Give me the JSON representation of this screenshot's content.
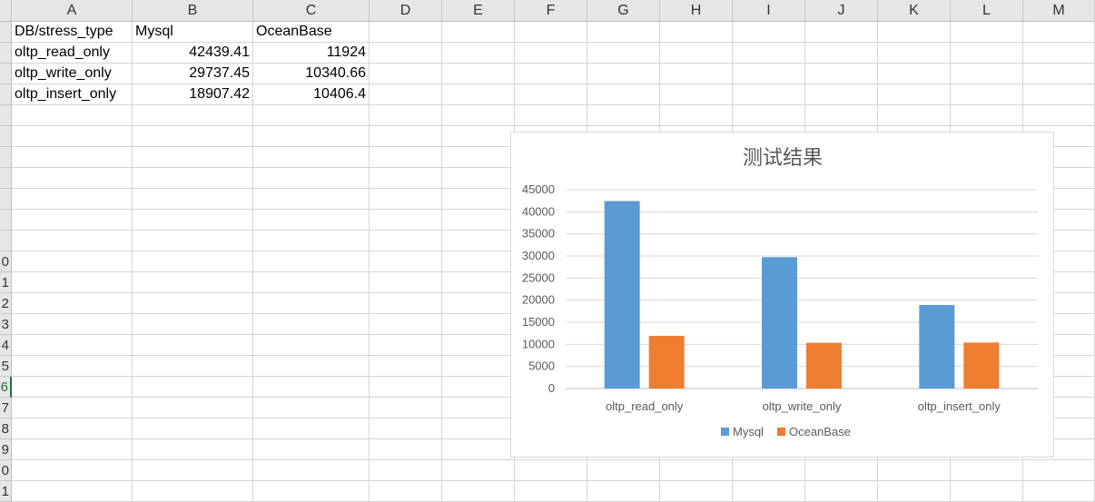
{
  "columns": [
    "A",
    "B",
    "C",
    "D",
    "E",
    "F",
    "G",
    "H",
    "I",
    "J",
    "K",
    "L",
    "M"
  ],
  "row_headers": [
    "",
    "",
    "",
    "",
    "",
    "",
    "",
    "",
    "",
    "",
    "",
    "0",
    "1",
    "2",
    "3",
    "4",
    "5",
    "6",
    "7",
    "8",
    "9",
    "0",
    "1"
  ],
  "active_row_index": 17,
  "cells": {
    "header": [
      "DB/stress_type",
      "Mysql",
      "OceanBase"
    ],
    "rows": [
      [
        "oltp_read_only",
        "42439.41",
        "11924"
      ],
      [
        "oltp_write_only",
        "29737.45",
        "10340.66"
      ],
      [
        "oltp_insert_only",
        "18907.42",
        "10406.4"
      ]
    ]
  },
  "chart_data": {
    "type": "bar",
    "title": "测试结果",
    "categories": [
      "oltp_read_only",
      "oltp_write_only",
      "oltp_insert_only"
    ],
    "series": [
      {
        "name": "Mysql",
        "values": [
          42439.41,
          29737.45,
          18907.42
        ],
        "color": "#5b9bd5"
      },
      {
        "name": "OceanBase",
        "values": [
          11924,
          10340.66,
          10406.4
        ],
        "color": "#ed7d31"
      }
    ],
    "ylim": [
      0,
      45000
    ],
    "yticks": [
      "0",
      "5000",
      "10000",
      "15000",
      "20000",
      "25000",
      "30000",
      "35000",
      "40000",
      "45000"
    ],
    "grid": true,
    "legend_position": "bottom"
  }
}
